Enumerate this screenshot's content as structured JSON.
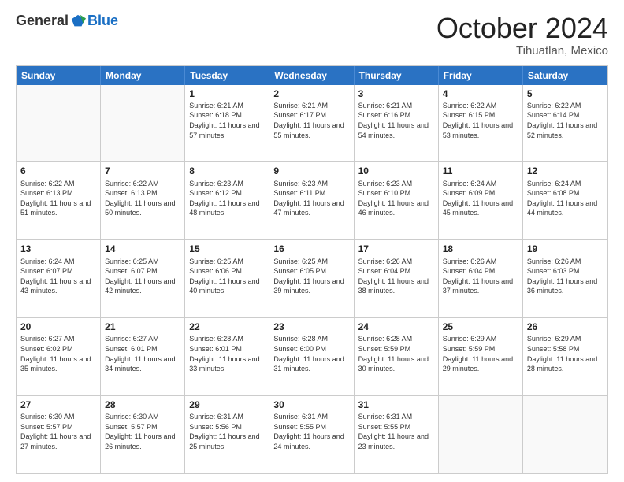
{
  "logo": {
    "general": "General",
    "blue": "Blue",
    "tagline": ""
  },
  "title": "October 2024",
  "subtitle": "Tihuatlan, Mexico",
  "header_days": [
    "Sunday",
    "Monday",
    "Tuesday",
    "Wednesday",
    "Thursday",
    "Friday",
    "Saturday"
  ],
  "rows": [
    [
      {
        "day": "",
        "empty": true
      },
      {
        "day": "",
        "empty": true
      },
      {
        "day": "1",
        "sunrise": "Sunrise: 6:21 AM",
        "sunset": "Sunset: 6:18 PM",
        "daylight": "Daylight: 11 hours and 57 minutes."
      },
      {
        "day": "2",
        "sunrise": "Sunrise: 6:21 AM",
        "sunset": "Sunset: 6:17 PM",
        "daylight": "Daylight: 11 hours and 55 minutes."
      },
      {
        "day": "3",
        "sunrise": "Sunrise: 6:21 AM",
        "sunset": "Sunset: 6:16 PM",
        "daylight": "Daylight: 11 hours and 54 minutes."
      },
      {
        "day": "4",
        "sunrise": "Sunrise: 6:22 AM",
        "sunset": "Sunset: 6:15 PM",
        "daylight": "Daylight: 11 hours and 53 minutes."
      },
      {
        "day": "5",
        "sunrise": "Sunrise: 6:22 AM",
        "sunset": "Sunset: 6:14 PM",
        "daylight": "Daylight: 11 hours and 52 minutes."
      }
    ],
    [
      {
        "day": "6",
        "sunrise": "Sunrise: 6:22 AM",
        "sunset": "Sunset: 6:13 PM",
        "daylight": "Daylight: 11 hours and 51 minutes."
      },
      {
        "day": "7",
        "sunrise": "Sunrise: 6:22 AM",
        "sunset": "Sunset: 6:13 PM",
        "daylight": "Daylight: 11 hours and 50 minutes."
      },
      {
        "day": "8",
        "sunrise": "Sunrise: 6:23 AM",
        "sunset": "Sunset: 6:12 PM",
        "daylight": "Daylight: 11 hours and 48 minutes."
      },
      {
        "day": "9",
        "sunrise": "Sunrise: 6:23 AM",
        "sunset": "Sunset: 6:11 PM",
        "daylight": "Daylight: 11 hours and 47 minutes."
      },
      {
        "day": "10",
        "sunrise": "Sunrise: 6:23 AM",
        "sunset": "Sunset: 6:10 PM",
        "daylight": "Daylight: 11 hours and 46 minutes."
      },
      {
        "day": "11",
        "sunrise": "Sunrise: 6:24 AM",
        "sunset": "Sunset: 6:09 PM",
        "daylight": "Daylight: 11 hours and 45 minutes."
      },
      {
        "day": "12",
        "sunrise": "Sunrise: 6:24 AM",
        "sunset": "Sunset: 6:08 PM",
        "daylight": "Daylight: 11 hours and 44 minutes."
      }
    ],
    [
      {
        "day": "13",
        "sunrise": "Sunrise: 6:24 AM",
        "sunset": "Sunset: 6:07 PM",
        "daylight": "Daylight: 11 hours and 43 minutes."
      },
      {
        "day": "14",
        "sunrise": "Sunrise: 6:25 AM",
        "sunset": "Sunset: 6:07 PM",
        "daylight": "Daylight: 11 hours and 42 minutes."
      },
      {
        "day": "15",
        "sunrise": "Sunrise: 6:25 AM",
        "sunset": "Sunset: 6:06 PM",
        "daylight": "Daylight: 11 hours and 40 minutes."
      },
      {
        "day": "16",
        "sunrise": "Sunrise: 6:25 AM",
        "sunset": "Sunset: 6:05 PM",
        "daylight": "Daylight: 11 hours and 39 minutes."
      },
      {
        "day": "17",
        "sunrise": "Sunrise: 6:26 AM",
        "sunset": "Sunset: 6:04 PM",
        "daylight": "Daylight: 11 hours and 38 minutes."
      },
      {
        "day": "18",
        "sunrise": "Sunrise: 6:26 AM",
        "sunset": "Sunset: 6:04 PM",
        "daylight": "Daylight: 11 hours and 37 minutes."
      },
      {
        "day": "19",
        "sunrise": "Sunrise: 6:26 AM",
        "sunset": "Sunset: 6:03 PM",
        "daylight": "Daylight: 11 hours and 36 minutes."
      }
    ],
    [
      {
        "day": "20",
        "sunrise": "Sunrise: 6:27 AM",
        "sunset": "Sunset: 6:02 PM",
        "daylight": "Daylight: 11 hours and 35 minutes."
      },
      {
        "day": "21",
        "sunrise": "Sunrise: 6:27 AM",
        "sunset": "Sunset: 6:01 PM",
        "daylight": "Daylight: 11 hours and 34 minutes."
      },
      {
        "day": "22",
        "sunrise": "Sunrise: 6:28 AM",
        "sunset": "Sunset: 6:01 PM",
        "daylight": "Daylight: 11 hours and 33 minutes."
      },
      {
        "day": "23",
        "sunrise": "Sunrise: 6:28 AM",
        "sunset": "Sunset: 6:00 PM",
        "daylight": "Daylight: 11 hours and 31 minutes."
      },
      {
        "day": "24",
        "sunrise": "Sunrise: 6:28 AM",
        "sunset": "Sunset: 5:59 PM",
        "daylight": "Daylight: 11 hours and 30 minutes."
      },
      {
        "day": "25",
        "sunrise": "Sunrise: 6:29 AM",
        "sunset": "Sunset: 5:59 PM",
        "daylight": "Daylight: 11 hours and 29 minutes."
      },
      {
        "day": "26",
        "sunrise": "Sunrise: 6:29 AM",
        "sunset": "Sunset: 5:58 PM",
        "daylight": "Daylight: 11 hours and 28 minutes."
      }
    ],
    [
      {
        "day": "27",
        "sunrise": "Sunrise: 6:30 AM",
        "sunset": "Sunset: 5:57 PM",
        "daylight": "Daylight: 11 hours and 27 minutes."
      },
      {
        "day": "28",
        "sunrise": "Sunrise: 6:30 AM",
        "sunset": "Sunset: 5:57 PM",
        "daylight": "Daylight: 11 hours and 26 minutes."
      },
      {
        "day": "29",
        "sunrise": "Sunrise: 6:31 AM",
        "sunset": "Sunset: 5:56 PM",
        "daylight": "Daylight: 11 hours and 25 minutes."
      },
      {
        "day": "30",
        "sunrise": "Sunrise: 6:31 AM",
        "sunset": "Sunset: 5:55 PM",
        "daylight": "Daylight: 11 hours and 24 minutes."
      },
      {
        "day": "31",
        "sunrise": "Sunrise: 6:31 AM",
        "sunset": "Sunset: 5:55 PM",
        "daylight": "Daylight: 11 hours and 23 minutes."
      },
      {
        "day": "",
        "empty": true
      },
      {
        "day": "",
        "empty": true
      }
    ]
  ]
}
